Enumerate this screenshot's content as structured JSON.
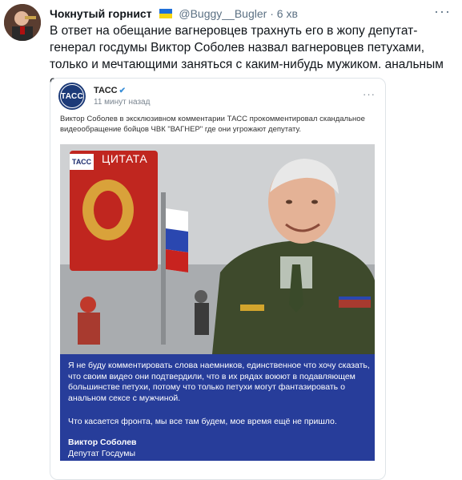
{
  "tweet": {
    "author_name": "Чокнутый горнист",
    "handle": "@Buggy__Bugler",
    "separator": "·",
    "time": "6 хв",
    "text": "В ответ на обещание вагнеровцев трахнуть его в жопу депутат-генерал госдумы Виктор Соболев назвал вагнеровцев петухами, только и мечтающими заняться с каким-нибудь мужиком. анальным сексом",
    "more_icon": "more-dots-icon",
    "flag_colors": [
      "#1f6fd8",
      "#f7d511"
    ]
  },
  "card": {
    "source_name": "ТАСС",
    "logo_text": "ТАСС",
    "time": "11 минут назад",
    "description": "Виктор Соболев в эксклюзивном комментарии ТАСС прокомментировал скандальное видеообращение бойцов ЧВК \"ВАГНЕР\" где они угрожают депутату.",
    "image": {
      "tag_logo": "ТАСС",
      "tag_label": "ЦИТАТА"
    },
    "quote": {
      "paragraph1": "Я не буду комментировать слова наемников, единственное что хочу сказать, что своим видео они подтвердили, что в их рядах воюют в подавляющем большинстве петухи, потому что только петухи могут фантазировать о анальном сексе с мужчиной.",
      "paragraph2": "Что касается фронта, мы все там будем, мое время ещё не пришло.",
      "author": "Виктор Соболев",
      "role": "Депутат Госдумы"
    },
    "colors": {
      "quote_bg": "#273d9a",
      "tass_blue": "#1c3a78"
    }
  }
}
